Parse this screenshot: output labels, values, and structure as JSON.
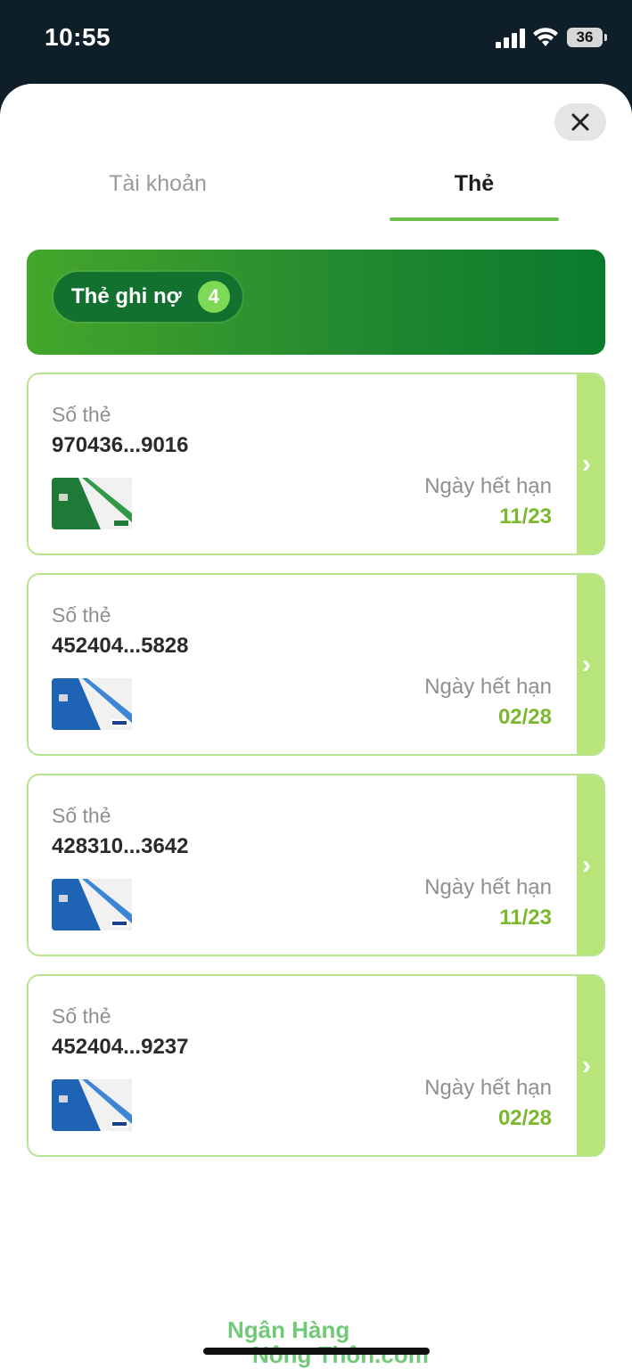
{
  "status_bar": {
    "time": "10:55",
    "battery": "36"
  },
  "tabs": [
    {
      "label": "Tài khoản",
      "active": false
    },
    {
      "label": "Thẻ",
      "active": true
    }
  ],
  "section": {
    "label": "Thẻ ghi nợ",
    "count": "4"
  },
  "cards": [
    {
      "label": "Số thẻ",
      "number": "970436...9016",
      "expiry_label": "Ngày hết hạn",
      "expiry": "11/23",
      "type": "napas"
    },
    {
      "label": "Số thẻ",
      "number": "452404...5828",
      "expiry_label": "Ngày hết hạn",
      "expiry": "02/28",
      "type": "visa"
    },
    {
      "label": "Số thẻ",
      "number": "428310...3642",
      "expiry_label": "Ngày hết hạn",
      "expiry": "11/23",
      "type": "visa"
    },
    {
      "label": "Số thẻ",
      "number": "452404...9237",
      "expiry_label": "Ngày hết hạn",
      "expiry": "02/28",
      "type": "visa"
    }
  ],
  "watermark": {
    "line1": "Ngân Hàng",
    "line2": "Nông Thôn.com"
  },
  "colors": {
    "accent": "#6cc04a",
    "expiry": "#7ab82e",
    "strip": "#b7e57a"
  }
}
